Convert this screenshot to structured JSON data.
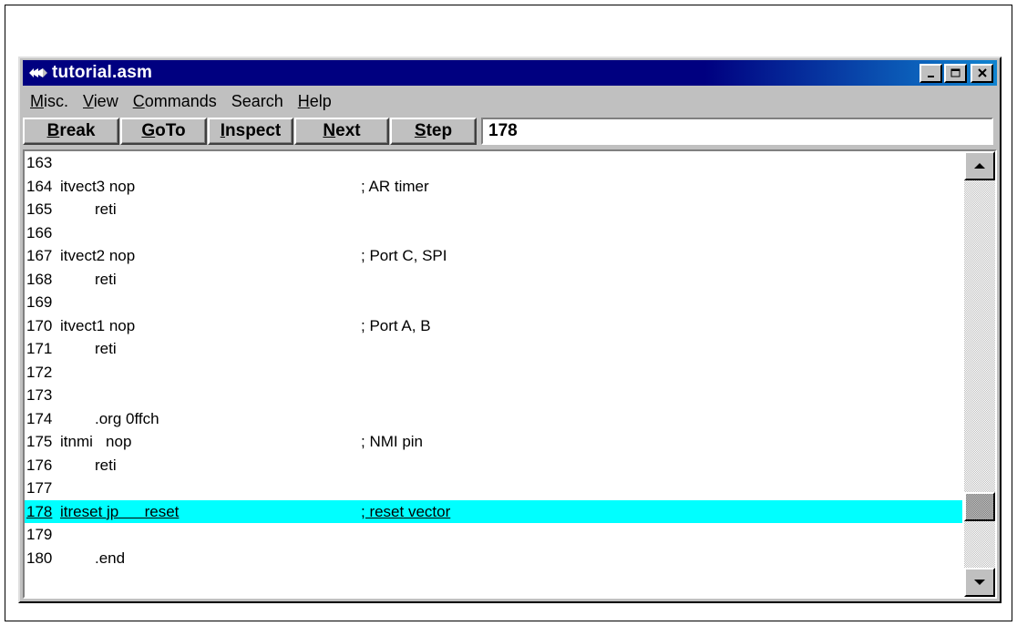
{
  "window": {
    "title": "tutorial.asm"
  },
  "menu": {
    "items": [
      {
        "label_ul": "M",
        "label_rest": "isc."
      },
      {
        "label_ul": "V",
        "label_rest": "iew"
      },
      {
        "label_ul": "C",
        "label_rest": "ommands"
      },
      {
        "label_ul": "",
        "label_rest": "Search"
      },
      {
        "label_ul": "H",
        "label_rest": "elp"
      }
    ]
  },
  "toolbar": {
    "buttons": [
      {
        "label_ul": "B",
        "label_rest": "reak"
      },
      {
        "label_ul": "G",
        "label_rest": "oTo"
      },
      {
        "label_ul": "I",
        "label_rest": "nspect"
      },
      {
        "label_ul": "N",
        "label_rest": "ext"
      },
      {
        "label_ul": "S",
        "label_rest": "tep"
      }
    ],
    "goto_value": "178"
  },
  "code": {
    "highlight_line": "178",
    "lines": [
      {
        "num": "163",
        "label": "",
        "instr": "",
        "comment": ""
      },
      {
        "num": "164",
        "label": "itvect3 nop",
        "instr": "",
        "comment": "; AR timer"
      },
      {
        "num": "165",
        "label": "",
        "instr": "reti",
        "comment": ""
      },
      {
        "num": "166",
        "label": "",
        "instr": "",
        "comment": ""
      },
      {
        "num": "167",
        "label": "itvect2 nop",
        "instr": "",
        "comment": "; Port C, SPI"
      },
      {
        "num": "168",
        "label": "",
        "instr": "reti",
        "comment": ""
      },
      {
        "num": "169",
        "label": "",
        "instr": "",
        "comment": ""
      },
      {
        "num": "170",
        "label": "itvect1 nop",
        "instr": "",
        "comment": "; Port A, B"
      },
      {
        "num": "171",
        "label": "",
        "instr": "reti",
        "comment": ""
      },
      {
        "num": "172",
        "label": "",
        "instr": "",
        "comment": ""
      },
      {
        "num": "173",
        "label": "",
        "instr": "",
        "comment": ""
      },
      {
        "num": "174",
        "label": "",
        "instr": ".org 0ffch",
        "comment": ""
      },
      {
        "num": "175",
        "label": "itnmi   nop",
        "instr": "",
        "comment": "; NMI pin"
      },
      {
        "num": "176",
        "label": "",
        "instr": "reti",
        "comment": ""
      },
      {
        "num": "177",
        "label": "",
        "instr": "",
        "comment": ""
      },
      {
        "num": "178",
        "label": "itreset jp      reset",
        "instr": "",
        "comment": "; reset vector"
      },
      {
        "num": "179",
        "label": "",
        "instr": "",
        "comment": ""
      },
      {
        "num": "180",
        "label": "",
        "instr": ".end",
        "comment": ""
      }
    ]
  },
  "scrollbar": {
    "position_fraction": 0.87
  },
  "colors": {
    "titlebar": "#000080",
    "highlight": "#00ffff",
    "face": "#c0c0c0"
  }
}
